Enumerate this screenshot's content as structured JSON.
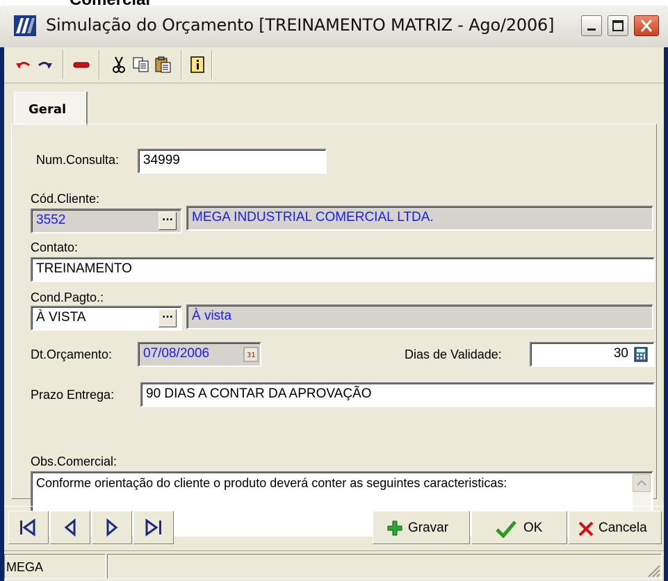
{
  "caption": "Comercial",
  "window": {
    "title": "Simulação do Orçamento [TREINAMENTO MATRIZ - Ago/2006]",
    "minimize": "minimize",
    "maximize": "maximize",
    "close": "close"
  },
  "toolbar": {
    "icons": [
      "undo-icon",
      "redo-icon",
      "delete-icon",
      "cut-icon",
      "copy-icon",
      "paste-icon",
      "info-icon"
    ]
  },
  "tab": {
    "label": "Geral"
  },
  "form": {
    "num_consulta_label": "Num.Consulta:",
    "num_consulta_value": "34999",
    "cod_cliente_label": "Cód.Cliente:",
    "cod_cliente_value": "3552",
    "cliente_nome": "MEGA INDUSTRIAL COMERCIAL LTDA.",
    "contato_label": "Contato:",
    "contato_value": "TREINAMENTO",
    "cond_pagto_label": "Cond.Pagto.:",
    "cond_pagto_value": "À VISTA",
    "cond_pagto_desc": "À vista",
    "dt_orcamento_label": "Dt.Orçamento:",
    "dt_orcamento_value": "07/08/2006",
    "dias_validade_label": "Dias de Validade:",
    "dias_validade_value": "30",
    "prazo_entrega_label": "Prazo Entrega:",
    "prazo_entrega_value": "90 DIAS A CONTAR DA APROVAÇÃO",
    "obs_label": "Obs.Comercial:",
    "obs_value": "Conforme orientação do cliente o produto deverá conter as seguintes caracteristicas:"
  },
  "buttons": {
    "gravar": "Gravar",
    "ok": "OK",
    "cancela": "Cancela",
    "lookup": "..."
  },
  "status": {
    "panel1": "MEGA"
  },
  "colors": {
    "titlebar": "#dcdad2",
    "client": "#ece9d8",
    "link": "#1a1aff"
  }
}
